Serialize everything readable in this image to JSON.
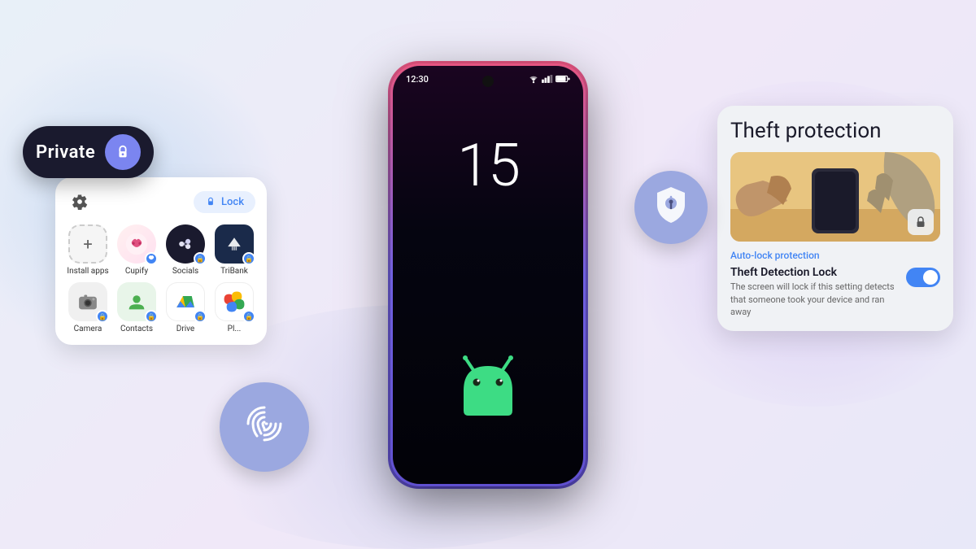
{
  "background": {
    "gradient_start": "#e8f0f8",
    "gradient_mid": "#f0e8f8",
    "gradient_end": "#e8e8f8"
  },
  "phone": {
    "time": "12:30",
    "number": "15",
    "border_gradient_top": "#e85580",
    "border_gradient_bottom": "#6050d0"
  },
  "private_pill": {
    "label": "Private",
    "lock_icon": "🔒",
    "bg": "#1a1a2e",
    "btn_color": "#7b85f0"
  },
  "app_drawer": {
    "lock_label": "Lock",
    "apps": [
      {
        "name": "Install apps",
        "type": "install"
      },
      {
        "name": "Cupify",
        "type": "cupify",
        "emoji": "🫶"
      },
      {
        "name": "Socials",
        "type": "socials",
        "emoji": "⬤"
      },
      {
        "name": "TriBank",
        "type": "tribank",
        "emoji": "🏦"
      },
      {
        "name": "Camera",
        "type": "camera",
        "emoji": "📷"
      },
      {
        "name": "Contacts",
        "type": "contacts",
        "emoji": "👤"
      },
      {
        "name": "Drive",
        "type": "drive",
        "emoji": "▲"
      },
      {
        "name": "Photos",
        "type": "photos",
        "emoji": "✿"
      }
    ]
  },
  "theft_card": {
    "title": "Theft protection",
    "auto_lock_label": "Auto-lock protection",
    "detection_title": "Theft Detection Lock",
    "detection_desc": "The screen will lock if this setting detects that someone took your device and ran away",
    "toggle_state": true
  },
  "fingerprint_bubble": {
    "icon": "fingerprint",
    "color": "#9ba8e0"
  },
  "shield_bubble": {
    "icon": "shield",
    "color": "#9ba8e0"
  }
}
